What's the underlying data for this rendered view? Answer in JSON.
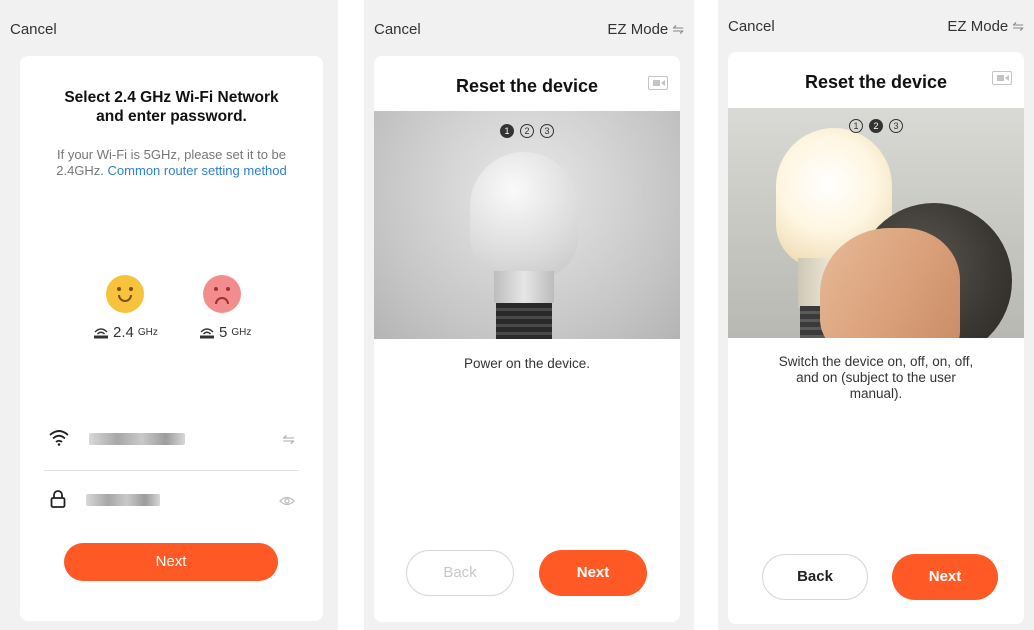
{
  "screen1": {
    "cancel": "Cancel",
    "title": "Select 2.4 GHz Wi-Fi Network and enter password.",
    "description": "If your Wi-Fi is 5GHz, please set it to be 2.4GHz.",
    "link": "Common router setting method",
    "band_good": {
      "value": "2.4",
      "unit": "GHz",
      "face": "smile-icon"
    },
    "band_bad": {
      "value": "5",
      "unit": "GHz",
      "face": "frown-icon"
    },
    "next_label": "Next",
    "accent": "#ff5a26"
  },
  "screen2": {
    "cancel": "Cancel",
    "mode": "EZ Mode",
    "title": "Reset the device",
    "steps": [
      "1",
      "2",
      "3"
    ],
    "active_step": 1,
    "caption": "Power on the device.",
    "back_label": "Back",
    "next_label": "Next"
  },
  "screen3": {
    "cancel": "Cancel",
    "mode": "EZ Mode",
    "title": "Reset the device",
    "steps": [
      "1",
      "2",
      "3"
    ],
    "active_step": 2,
    "caption": "Switch the device on, off, on, off, and on (subject to the user manual).",
    "back_label": "Back",
    "next_label": "Next"
  }
}
